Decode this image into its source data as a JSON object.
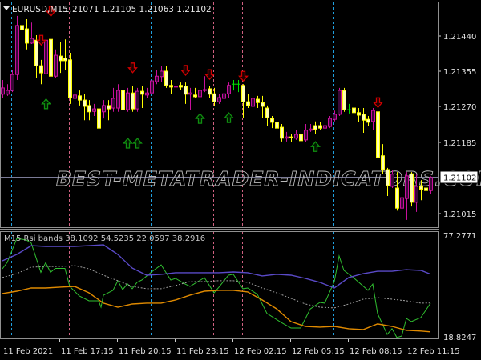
{
  "header": {
    "symbol": "EURUSD,M15",
    "ohlc_text": "1.21071 1.21105 1.21063 1.21102"
  },
  "watermark": "BEST-METATRADER-INDICATORS.COM",
  "price_axis": {
    "labels": [
      "1.21440",
      "1.21355",
      "1.21270",
      "1.21185",
      "1.21015"
    ],
    "current_price": "1.21102"
  },
  "time_axis": {
    "labels": [
      "11 Feb 2021",
      "11 Feb 17:15",
      "11 Feb 20:15",
      "11 Feb 23:15",
      "12 Feb 02:15",
      "12 Feb 05:15",
      "12 Feb 08:15",
      "12 Feb 11:15"
    ]
  },
  "colors": {
    "bull_outline": "#c8109c",
    "bull_fill": "#3a0838",
    "bear_outline": "#ffff00",
    "bear_fill": "#ffffb0",
    "doji": "#00e000",
    "sell_arrow": "#d00000",
    "buy_arrow": "#109010",
    "rsi": "#30c030",
    "upper_band": "#5a4ac8",
    "middle_band": "#a0a0a0",
    "lower_band": "#e08a00"
  },
  "chart_data": {
    "type": "candlestick",
    "symbol": "EURUSD",
    "timeframe": "M15",
    "price_base": 1.21,
    "point": 1e-05,
    "ohlc_points": [
      [
        1301,
        1335,
        1293,
        1316
      ],
      [
        1301,
        1325,
        1297,
        1310
      ],
      [
        1310,
        1358,
        1306,
        1348
      ],
      [
        1348,
        1488,
        1335,
        1465
      ],
      [
        1465,
        1480,
        1442,
        1455
      ],
      [
        1457,
        1480,
        1408,
        1423
      ],
      [
        1423,
        1472,
        1421,
        1434
      ],
      [
        1430,
        1442,
        1339,
        1369
      ],
      [
        1369,
        1383,
        1325,
        1352
      ],
      [
        1350,
        1446,
        1344,
        1430
      ],
      [
        1432,
        1448,
        1316,
        1344
      ],
      [
        1344,
        1408,
        1339,
        1394
      ],
      [
        1392,
        1425,
        1352,
        1381
      ],
      [
        1387,
        1432,
        1358,
        1381
      ],
      [
        1383,
        1400,
        1278,
        1293
      ],
      [
        1291,
        1325,
        1268,
        1299
      ],
      [
        1297,
        1310,
        1274,
        1287
      ],
      [
        1287,
        1301,
        1239,
        1272
      ],
      [
        1274,
        1287,
        1239,
        1259
      ],
      [
        1260,
        1278,
        1249,
        1266
      ],
      [
        1266,
        1281,
        1211,
        1220
      ],
      [
        1259,
        1287,
        1243,
        1274
      ],
      [
        1274,
        1287,
        1239,
        1266
      ],
      [
        1268,
        1316,
        1259,
        1291
      ],
      [
        1268,
        1325,
        1259,
        1310
      ],
      [
        1310,
        1320,
        1259,
        1264
      ],
      [
        1264,
        1316,
        1259,
        1304
      ],
      [
        1304,
        1320,
        1259,
        1266
      ],
      [
        1266,
        1316,
        1259,
        1308
      ],
      [
        1308,
        1320,
        1268,
        1301
      ],
      [
        1299,
        1316,
        1293,
        1304
      ],
      [
        1304,
        1344,
        1293,
        1333
      ],
      [
        1331,
        1358,
        1325,
        1344
      ],
      [
        1343,
        1369,
        1331,
        1356
      ],
      [
        1356,
        1369,
        1316,
        1322
      ],
      [
        1322,
        1335,
        1301,
        1318
      ],
      [
        1318,
        1325,
        1304,
        1320
      ],
      [
        1322,
        1329,
        1312,
        1318
      ],
      [
        1320,
        1329,
        1278,
        1301
      ],
      [
        1301,
        1316,
        1264,
        1304
      ],
      [
        1299,
        1316,
        1291,
        1295
      ],
      [
        1295,
        1331,
        1293,
        1310
      ],
      [
        1310,
        1344,
        1306,
        1312
      ],
      [
        1314,
        1320,
        1293,
        1301
      ],
      [
        1302,
        1316,
        1272,
        1283
      ],
      [
        1283,
        1301,
        1278,
        1293
      ],
      [
        1291,
        1310,
        1281,
        1302
      ],
      [
        1302,
        1329,
        1293,
        1322
      ],
      [
        1325,
        1335,
        1310,
        1325
      ],
      [
        1325,
        1335,
        1306,
        1325
      ],
      [
        1322,
        1325,
        1245,
        1283
      ],
      [
        1283,
        1302,
        1268,
        1274
      ],
      [
        1272,
        1297,
        1262,
        1291
      ],
      [
        1289,
        1297,
        1268,
        1281
      ],
      [
        1281,
        1297,
        1245,
        1272
      ],
      [
        1268,
        1274,
        1226,
        1245
      ],
      [
        1243,
        1249,
        1220,
        1234
      ],
      [
        1234,
        1243,
        1205,
        1220
      ],
      [
        1222,
        1230,
        1188,
        1196
      ],
      [
        1196,
        1211,
        1188,
        1199
      ],
      [
        1199,
        1207,
        1186,
        1197
      ],
      [
        1196,
        1215,
        1192,
        1205
      ],
      [
        1205,
        1215,
        1186,
        1190
      ],
      [
        1192,
        1230,
        1186,
        1215
      ],
      [
        1215,
        1230,
        1211,
        1218
      ],
      [
        1226,
        1236,
        1205,
        1217
      ],
      [
        1226,
        1234,
        1215,
        1220
      ],
      [
        1220,
        1236,
        1217,
        1226
      ],
      [
        1224,
        1249,
        1220,
        1243
      ],
      [
        1241,
        1262,
        1236,
        1253
      ],
      [
        1253,
        1316,
        1249,
        1310
      ],
      [
        1310,
        1316,
        1259,
        1264
      ],
      [
        1264,
        1278,
        1255,
        1264
      ],
      [
        1268,
        1281,
        1239,
        1257
      ],
      [
        1257,
        1268,
        1234,
        1251
      ],
      [
        1253,
        1268,
        1209,
        1239
      ],
      [
        1241,
        1249,
        1226,
        1234
      ],
      [
        1236,
        1268,
        1215,
        1262
      ],
      [
        1259,
        1262,
        1125,
        1150
      ],
      [
        1154,
        1182,
        1110,
        1121
      ],
      [
        1121,
        1125,
        1058,
        1083
      ],
      [
        1081,
        1121,
        1077,
        1110
      ],
      [
        1077,
        1115,
        1023,
        1029
      ],
      [
        1029,
        1087,
        1005,
        1054
      ],
      [
        1052,
        1115,
        1001,
        1106
      ],
      [
        1111,
        1115,
        1033,
        1043
      ],
      [
        1043,
        1110,
        1020,
        1081
      ],
      [
        1081,
        1096,
        1048,
        1074
      ],
      [
        1077,
        1110,
        1068,
        1071
      ],
      [
        1071,
        1105,
        1063,
        1102
      ]
    ],
    "sell_signals": [
      [
        8,
        1430
      ],
      [
        10,
        1499
      ],
      [
        27,
        1364
      ],
      [
        38,
        1358
      ],
      [
        43,
        1348
      ],
      [
        50,
        1344
      ],
      [
        78,
        1281
      ]
    ],
    "buy_signals": [
      [
        9,
        1278
      ],
      [
        26,
        1184
      ],
      [
        28,
        1184
      ],
      [
        41,
        1243
      ],
      [
        47,
        1245
      ],
      [
        65,
        1176
      ]
    ],
    "indicator": {
      "name": "M15 Rsi bands",
      "legend_text": "M15 Rsi bands 38.1092 54.5235 22.0597 38.2916",
      "scale_max": 77.2771,
      "scale_max_label": "77.2771",
      "scale_min": 18.8247,
      "scale_min_label": "18.8247",
      "series": [
        {
          "name": "RSI",
          "points": [
            [
              0,
              57.5
            ],
            [
              1,
              61.1
            ],
            [
              3,
              74.6
            ],
            [
              5,
              73.7
            ],
            [
              6,
              71.9
            ],
            [
              8,
              55.5
            ],
            [
              9,
              60.9
            ],
            [
              10,
              55.5
            ],
            [
              11,
              57.7
            ],
            [
              13,
              57.7
            ],
            [
              14,
              47.6
            ],
            [
              16,
              42.2
            ],
            [
              18,
              39.5
            ],
            [
              20,
              39.5
            ],
            [
              20.5,
              35.9
            ],
            [
              21,
              42.6
            ],
            [
              23,
              45.4
            ],
            [
              24,
              50.8
            ],
            [
              25,
              45.8
            ],
            [
              26,
              49.0
            ],
            [
              27,
              46.3
            ],
            [
              28,
              49.9
            ],
            [
              29,
              51.2
            ],
            [
              31,
              55.7
            ],
            [
              33,
              59.7
            ],
            [
              35,
              51.2
            ],
            [
              36,
              52.1
            ],
            [
              38,
              48.9
            ],
            [
              39,
              47.6
            ],
            [
              42,
              52.5
            ],
            [
              44,
              44.0
            ],
            [
              45,
              47.1
            ],
            [
              47,
              53.9
            ],
            [
              48,
              54.4
            ],
            [
              50,
              46.3
            ],
            [
              51,
              46.7
            ],
            [
              53,
              43.2
            ],
            [
              55,
              32.4
            ],
            [
              58,
              27.3
            ],
            [
              60,
              24.2
            ],
            [
              62,
              24.2
            ],
            [
              64,
              34.9
            ],
            [
              66,
              38.6
            ],
            [
              67,
              38.2
            ],
            [
              69,
              50.3
            ],
            [
              70,
              64.7
            ],
            [
              71,
              56.6
            ],
            [
              73,
              52.5
            ],
            [
              76,
              45.4
            ],
            [
              77,
              48.9
            ],
            [
              78,
              32.3
            ],
            [
              80,
              20.6
            ],
            [
              81,
              23.8
            ],
            [
              82,
              18.9
            ],
            [
              83,
              19.7
            ],
            [
              84,
              29.6
            ],
            [
              85,
              27.8
            ],
            [
              87,
              30.1
            ],
            [
              89,
              38.1092
            ]
          ]
        },
        {
          "name": "Upper band",
          "points": [
            [
              0,
              62.0
            ],
            [
              3,
              65.6
            ],
            [
              6,
              70.5
            ],
            [
              9,
              70.1
            ],
            [
              12,
              70.1
            ],
            [
              15,
              70.1
            ],
            [
              18,
              70.5
            ],
            [
              21,
              71.0
            ],
            [
              24,
              65.6
            ],
            [
              27,
              57.9
            ],
            [
              30,
              53.9
            ],
            [
              33,
              54.4
            ],
            [
              36,
              55.3
            ],
            [
              39,
              55.3
            ],
            [
              42,
              55.3
            ],
            [
              45,
              55.3
            ],
            [
              48,
              55.7
            ],
            [
              51,
              55.3
            ],
            [
              54,
              53.5
            ],
            [
              57,
              54.4
            ],
            [
              60,
              53.9
            ],
            [
              63,
              52.1
            ],
            [
              66,
              49.9
            ],
            [
              69,
              46.7
            ],
            [
              72,
              52.6
            ],
            [
              75,
              54.8
            ],
            [
              78,
              56.1
            ],
            [
              81,
              56.1
            ],
            [
              84,
              57.0
            ],
            [
              87,
              56.6
            ],
            [
              89,
              54.5235
            ]
          ]
        },
        {
          "name": "Lower band",
          "points": [
            [
              0,
              43.6
            ],
            [
              3,
              44.9
            ],
            [
              6,
              46.7
            ],
            [
              9,
              46.7
            ],
            [
              12,
              47.2
            ],
            [
              15,
              47.6
            ],
            [
              18,
              44.0
            ],
            [
              21,
              38.2
            ],
            [
              24,
              35.9
            ],
            [
              27,
              37.7
            ],
            [
              30,
              38.2
            ],
            [
              33,
              38.2
            ],
            [
              36,
              40.0
            ],
            [
              39,
              42.7
            ],
            [
              42,
              44.9
            ],
            [
              45,
              45.4
            ],
            [
              48,
              45.4
            ],
            [
              51,
              44.5
            ],
            [
              54,
              40.0
            ],
            [
              57,
              35.0
            ],
            [
              60,
              27.8
            ],
            [
              63,
              25.1
            ],
            [
              66,
              24.7
            ],
            [
              69,
              25.1
            ],
            [
              72,
              23.8
            ],
            [
              75,
              23.3
            ],
            [
              78,
              26.5
            ],
            [
              81,
              25.1
            ],
            [
              84,
              22.9
            ],
            [
              87,
              22.5
            ],
            [
              89,
              22.0597
            ]
          ]
        },
        {
          "name": "Middle band",
          "points": [
            [
              0,
              52.6
            ],
            [
              3,
              54.8
            ],
            [
              6,
              58.4
            ],
            [
              9,
              58.8
            ],
            [
              12,
              58.8
            ],
            [
              15,
              59.3
            ],
            [
              18,
              57.5
            ],
            [
              21,
              53.9
            ],
            [
              24,
              50.8
            ],
            [
              27,
              47.6
            ],
            [
              30,
              46.3
            ],
            [
              33,
              46.3
            ],
            [
              36,
              48.1
            ],
            [
              39,
              50.3
            ],
            [
              42,
              50.3
            ],
            [
              45,
              50.8
            ],
            [
              48,
              50.8
            ],
            [
              51,
              49.9
            ],
            [
              54,
              46.7
            ],
            [
              57,
              44.0
            ],
            [
              60,
              40.9
            ],
            [
              63,
              37.7
            ],
            [
              66,
              35.9
            ],
            [
              69,
              35.5
            ],
            [
              72,
              37.7
            ],
            [
              75,
              40.4
            ],
            [
              78,
              41.3
            ],
            [
              81,
              40.4
            ],
            [
              84,
              39.5
            ],
            [
              87,
              38.2
            ],
            [
              89,
              38.2916
            ]
          ]
        }
      ]
    }
  }
}
